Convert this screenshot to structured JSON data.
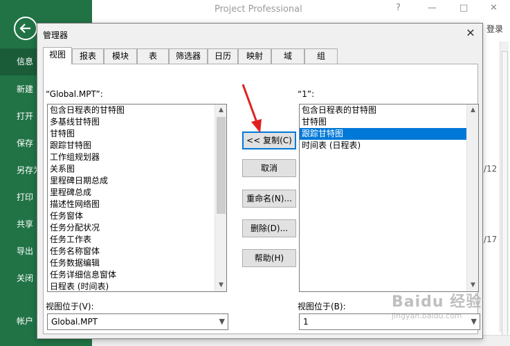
{
  "app": {
    "title": "Project Professional",
    "help_glyph": "?",
    "minimize_glyph": "—",
    "maximize_glyph": "□",
    "close_glyph": "✕",
    "login": "登录",
    "bg_dates": [
      "/12",
      "/17"
    ]
  },
  "backstage": {
    "items": [
      "信息",
      "新建",
      "打开",
      "保存",
      "另存为",
      "打印",
      "共享",
      "导出",
      "关闭",
      "帐户"
    ]
  },
  "dialog": {
    "title": "管理器",
    "close_glyph": "✕",
    "tabs": [
      "视图",
      "报表",
      "模块",
      "表",
      "筛选器",
      "日历",
      "映射",
      "域",
      "组"
    ],
    "left_header": "“Global.MPT”:",
    "right_header": "“1”:",
    "left_items": [
      "包含日程表的甘特图",
      "多基线甘特图",
      "甘特图",
      "跟踪甘特图",
      "工作组规划器",
      "关系图",
      "里程碑日期总成",
      "里程碑总成",
      "描述性网络图",
      "任务窗体",
      "任务分配状况",
      "任务工作表",
      "任务名称窗体",
      "任务数据编辑",
      "任务详细信息窗体",
      "日程表 (时间表)"
    ],
    "right_items": [
      "包含日程表的甘特图",
      "甘特图",
      "跟踪甘特图",
      "时间表 (日程表)"
    ],
    "right_selected_index": 2,
    "buttons": {
      "copy": "<< 复制(C)",
      "cancel": "取消",
      "rename": "重命名(N)...",
      "delete": "删除(D)...",
      "help": "帮助(H)"
    },
    "left_location_label": "视图位于(V):",
    "right_location_label": "视图位于(B):",
    "left_location_value": "Global.MPT",
    "right_location_value": "1"
  },
  "watermark": {
    "main": "Baidu 经验",
    "sub": "jingyan.baidu.com"
  },
  "colors": {
    "backstage_green": "#217346",
    "selection_blue": "#0078d7",
    "annotation_red": "#e02020"
  }
}
